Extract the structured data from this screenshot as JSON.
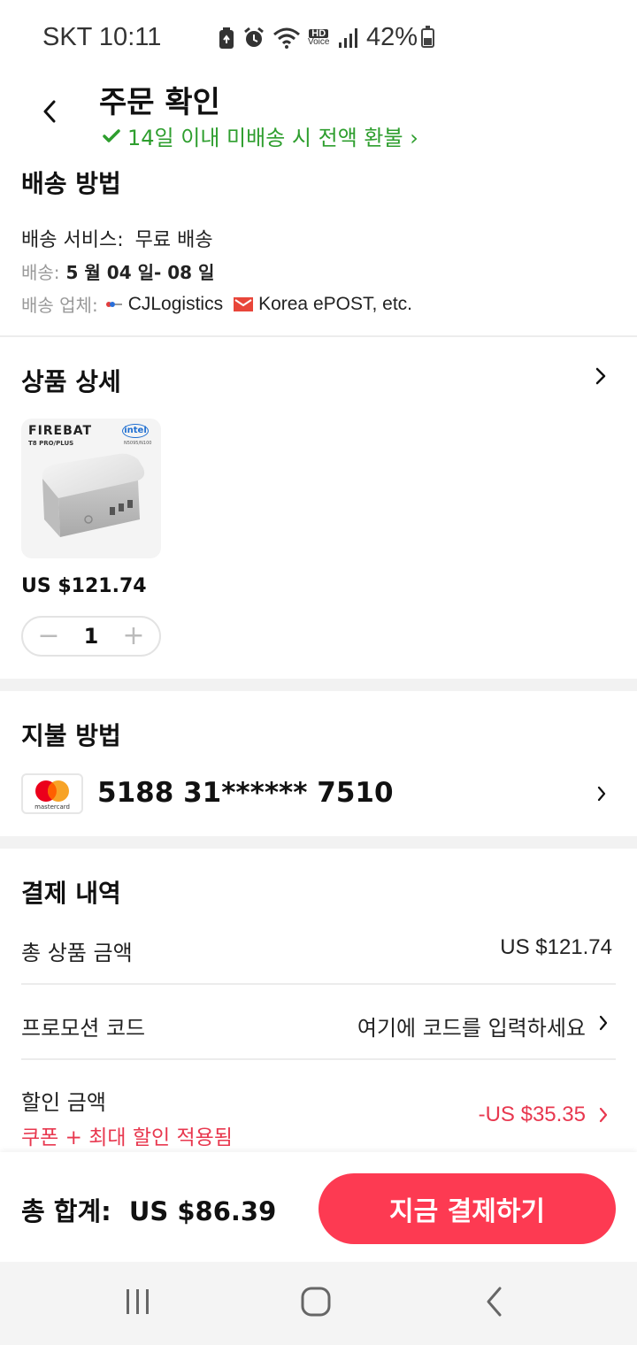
{
  "status_bar": {
    "carrier_time": "SKT 10:11",
    "battery_percent": "42%",
    "battery_level": 0.42,
    "icons": [
      "battery-saver-icon",
      "alarm-icon",
      "wifi-icon",
      "hd-voice-icon",
      "signal-icon",
      "battery-icon"
    ],
    "hd_label": "HD",
    "voice_label": "Voice"
  },
  "header": {
    "title": "주문 확인",
    "refund_notice": "14일 이내 미배송 시 전액 환불 ›"
  },
  "shipping": {
    "title": "배송 방법",
    "service_label": "배송 서비스:",
    "service_value": "무료 배송",
    "delivery_label": "배송:",
    "delivery_value": "5 월 04 일- 08 일",
    "carrier_label": "배송 업체:",
    "carrier_1": "CJLogistics",
    "carrier_2": "Korea ePOST, etc."
  },
  "product": {
    "title": "상품 상세",
    "brand": "FIREBAT",
    "model": "T8 PRO/PLUS",
    "chip_brand": "intel",
    "chip_model": "N5095/N100",
    "price": "US $121.74",
    "quantity": "1",
    "minus": "−",
    "plus": "+"
  },
  "payment": {
    "title": "지불 방법",
    "card_brand": "mastercard",
    "card_number": "5188 31****** 7510"
  },
  "summary": {
    "title": "결제 내역",
    "subtotal_label": "총 상품 금액",
    "subtotal_value": "US $121.74",
    "promo_label": "프로모션 코드",
    "promo_placeholder": "여기에 코드를 입력하세요",
    "discount_label": "할인 금액",
    "discount_note": "쿠폰 + 최대 할인 적용됨",
    "discount_value": "-US $35.35"
  },
  "bottom": {
    "total_label": "총 합계:",
    "total_value": "US $86.39",
    "pay_button": "지금 결제하기"
  },
  "colors": {
    "accent_red": "#fd3a52",
    "success_green": "#2e9e2e",
    "discount_red": "#e8384f"
  }
}
